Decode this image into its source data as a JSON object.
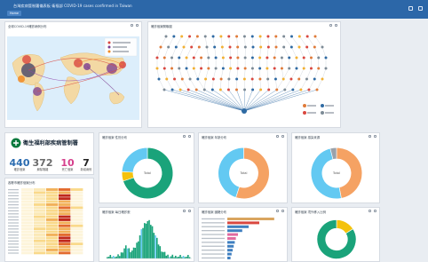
{
  "header": {
    "title": "台灣疾病管制署儀表板 衛福部 COVID-19 cases confirmed in Taiwan",
    "tabs": [
      "Home"
    ]
  },
  "panels": {
    "map": {
      "title": "全球COVID-19確診病例分布"
    },
    "network": {
      "title": "確診個案關聯圖"
    },
    "logo": {
      "name": "衛生福利部疾病管制署"
    },
    "heatmap": {
      "title": "各縣市確診個案分布"
    },
    "donut1": {
      "title": "確診個案 性別分布",
      "center": "Total"
    },
    "donut2": {
      "title": "確診個案 年齡分布",
      "center": "Total"
    },
    "donut3": {
      "title": "確診個案 感染來源",
      "center": "Total"
    },
    "histogram": {
      "title": "確診個案 每日確診數"
    },
    "bars": {
      "title": "確診個案 國籍分布"
    },
    "donut4": {
      "title": "確診個案 境外移入比例"
    }
  },
  "kpis": [
    {
      "value": "440",
      "label": "確診個案",
      "color": "#2b6cb0"
    },
    {
      "value": "372",
      "label": "解除隔離",
      "color": "#6b6b6b"
    },
    {
      "value": "10",
      "label": "死亡個案",
      "color": "#d53f8c"
    },
    {
      "value": "7",
      "label": "新增病例",
      "color": "#222222"
    }
  ],
  "colors": {
    "topbar": "#2c67a8",
    "teal": "#1aa37a",
    "orange": "#f5a263",
    "sky": "#63c9f2",
    "gold": "#f4c20d",
    "gray": "#9aa1aa"
  }
}
